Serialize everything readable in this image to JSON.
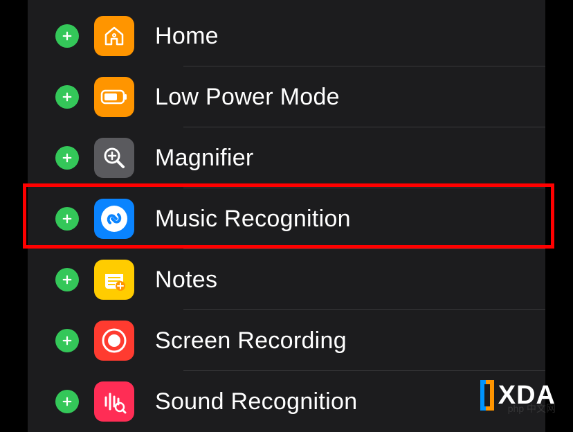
{
  "items": [
    {
      "id": "home",
      "label": "Home",
      "icon": "home-icon",
      "bg": "icon-home"
    },
    {
      "id": "low-power",
      "label": "Low Power Mode",
      "icon": "battery-icon",
      "bg": "icon-battery"
    },
    {
      "id": "magnifier",
      "label": "Magnifier",
      "icon": "magnifier-icon",
      "bg": "icon-magnifier"
    },
    {
      "id": "music-recognition",
      "label": "Music Recognition",
      "icon": "shazam-icon",
      "bg": "icon-music",
      "highlighted": true
    },
    {
      "id": "notes",
      "label": "Notes",
      "icon": "notes-icon",
      "bg": "icon-notes"
    },
    {
      "id": "screen-recording",
      "label": "Screen Recording",
      "icon": "record-icon",
      "bg": "icon-screen"
    },
    {
      "id": "sound-recognition",
      "label": "Sound Recognition",
      "icon": "sound-icon",
      "bg": "icon-sound"
    }
  ],
  "watermark": "XDA",
  "subwatermark": "php 中文网"
}
